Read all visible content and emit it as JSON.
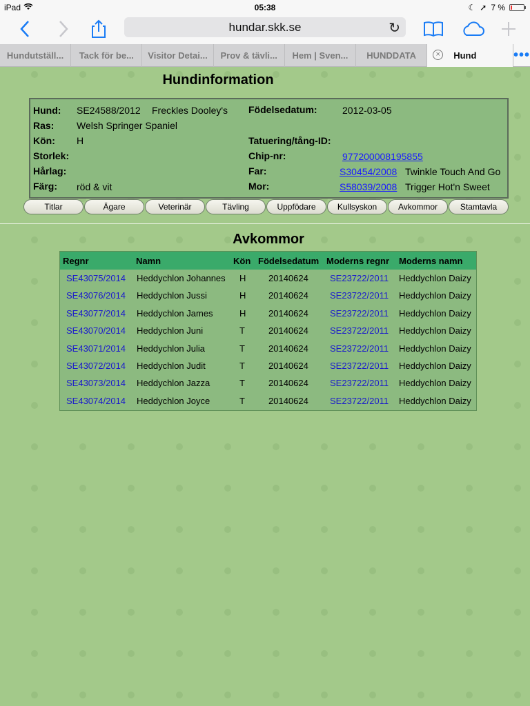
{
  "status": {
    "device": "iPad",
    "time": "05:38",
    "battery": "7 %",
    "battery_level": 0.07
  },
  "toolbar": {
    "url": "hundar.skk.se"
  },
  "tabs": [
    "Hundutställ...",
    "Tack för be...",
    "Visitor Detai...",
    "Prov & tävli...",
    "Hem | Sven...",
    "HUNDDATA",
    "Hund"
  ],
  "page": {
    "title": "Hundinformation",
    "labels": {
      "hund": "Hund:",
      "ras": "Ras:",
      "kon": "Kön:",
      "storlek": "Storlek:",
      "harlag": "Hårlag:",
      "farg": "Färg:",
      "fodelse": "Födelsedatum:",
      "tatuering": "Tatuering/tång-ID:",
      "chip": "Chip-nr:",
      "far": "Far:",
      "mor": "Mor:"
    },
    "values": {
      "regnr": "SE24588/2012",
      "name": "Freckles Dooley's",
      "ras": "Welsh Springer Spaniel",
      "kon": "H",
      "farg": "röd & vit",
      "fodelse": "2012-03-05",
      "chip": "977200008195855",
      "far_regnr": "S30454/2008",
      "far_namn": "Twinkle Touch And Go",
      "mor_regnr": "S58039/2008",
      "mor_namn": "Trigger Hot'n Sweet"
    },
    "buttons": [
      "Titlar",
      "Ägare",
      "Veterinär",
      "Tävling",
      "Uppfödare",
      "Kullsyskon",
      "Avkommor",
      "Stamtavla"
    ],
    "section_title": "Avkommor",
    "table": {
      "headers": [
        "Regnr",
        "Namn",
        "Kön",
        "Födelsedatum",
        "Moderns regnr",
        "Moderns namn"
      ],
      "rows": [
        [
          "SE43075/2014",
          "Heddychlon Johannes",
          "H",
          "20140624",
          "SE23722/2011",
          "Heddychlon Daizy"
        ],
        [
          "SE43076/2014",
          "Heddychlon Jussi",
          "H",
          "20140624",
          "SE23722/2011",
          "Heddychlon Daizy"
        ],
        [
          "SE43077/2014",
          "Heddychlon James",
          "H",
          "20140624",
          "SE23722/2011",
          "Heddychlon Daizy"
        ],
        [
          "SE43070/2014",
          "Heddychlon Juni",
          "T",
          "20140624",
          "SE23722/2011",
          "Heddychlon Daizy"
        ],
        [
          "SE43071/2014",
          "Heddychlon Julia",
          "T",
          "20140624",
          "SE23722/2011",
          "Heddychlon Daizy"
        ],
        [
          "SE43072/2014",
          "Heddychlon Judit",
          "T",
          "20140624",
          "SE23722/2011",
          "Heddychlon Daizy"
        ],
        [
          "SE43073/2014",
          "Heddychlon Jazza",
          "T",
          "20140624",
          "SE23722/2011",
          "Heddychlon Daizy"
        ],
        [
          "SE43074/2014",
          "Heddychlon Joyce",
          "T",
          "20140624",
          "SE23722/2011",
          "Heddychlon Daizy"
        ]
      ]
    }
  },
  "colors": {
    "accent": "#1a7cf5",
    "background": "#a3c98a",
    "table_header": "#3aaa6a",
    "link": "#1a1aff"
  }
}
